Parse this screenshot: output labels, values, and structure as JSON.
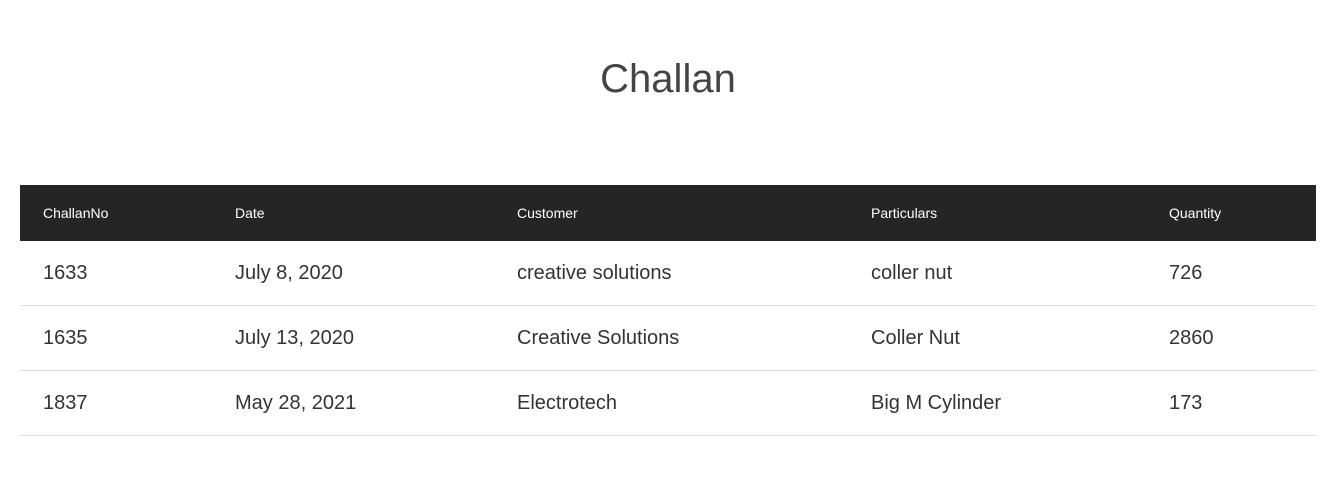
{
  "page": {
    "title": "Challan"
  },
  "table": {
    "headers": [
      "ChallanNo",
      "Date",
      "Customer",
      "Particulars",
      "Quantity"
    ],
    "rows": [
      [
        "1633",
        "July 8, 2020",
        "creative solutions",
        "coller nut",
        "726"
      ],
      [
        "1635",
        "July 13, 2020",
        "Creative Solutions",
        "Coller Nut",
        "2860"
      ],
      [
        "1837",
        "May 28, 2021",
        "Electrotech",
        "Big M Cylinder",
        "173"
      ]
    ]
  },
  "colors": {
    "header_bg": "#252525",
    "header_text": "#ffffff",
    "title_text": "#444444",
    "row_border": "#dddddd"
  }
}
